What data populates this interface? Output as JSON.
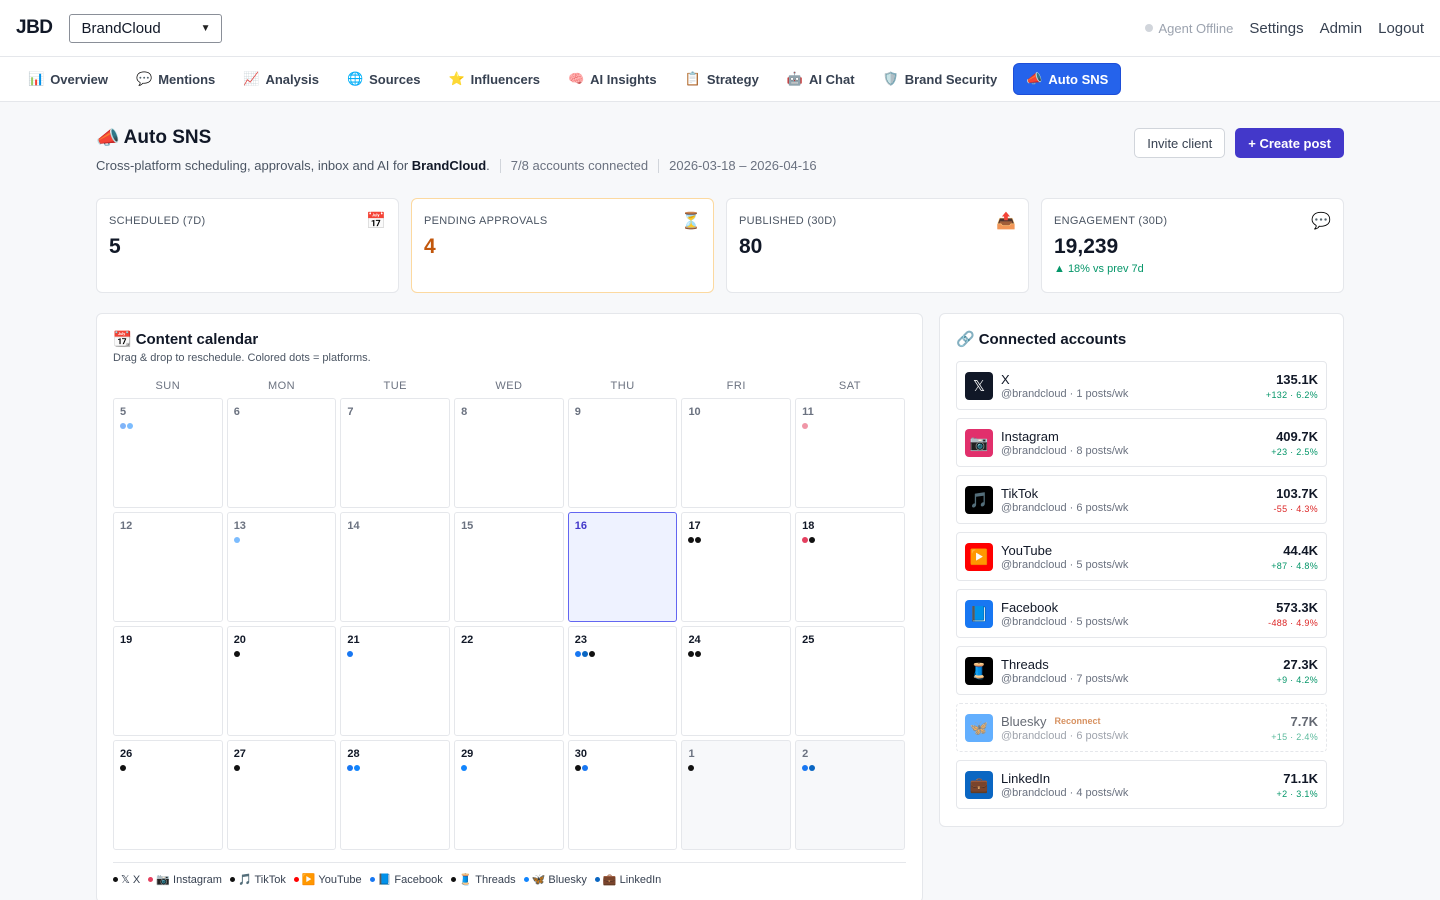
{
  "app": {
    "logo": "JBD",
    "brand_selected": "BrandCloud"
  },
  "topbar": {
    "agent_status": "Agent Offline",
    "links": [
      "Settings",
      "Admin",
      "Logout"
    ]
  },
  "nav": {
    "tabs": [
      {
        "icon": "📊",
        "label": "Overview"
      },
      {
        "icon": "💬",
        "label": "Mentions"
      },
      {
        "icon": "📈",
        "label": "Analysis"
      },
      {
        "icon": "🌐",
        "label": "Sources"
      },
      {
        "icon": "⭐",
        "label": "Influencers"
      },
      {
        "icon": "🧠",
        "label": "AI Insights"
      },
      {
        "icon": "📋",
        "label": "Strategy"
      },
      {
        "icon": "🤖",
        "label": "AI Chat"
      },
      {
        "icon": "🛡️",
        "label": "Brand Security"
      },
      {
        "icon": "📣",
        "label": "Auto SNS",
        "active": true
      }
    ]
  },
  "header": {
    "icon": "📣",
    "title": "Auto SNS",
    "subtitle_prefix": "Cross-platform scheduling, approvals, inbox and AI for ",
    "subtitle_brand": "BrandCloud",
    "subtitle_suffix": ".",
    "accounts_connected": "7/8 accounts connected",
    "date_range": "2026-03-18 – 2026-04-16",
    "invite_label": "Invite client",
    "create_label": "+ Create post"
  },
  "stats": [
    {
      "label": "SCHEDULED (7D)",
      "value": "5",
      "icon": "📅"
    },
    {
      "label": "PENDING APPROVALS",
      "value": "4",
      "icon": "⏳"
    },
    {
      "label": "PUBLISHED (30D)",
      "value": "80",
      "icon": "📤"
    },
    {
      "label": "ENGAGEMENT (30D)",
      "value": "19,239",
      "icon": "💬",
      "trend": "▲ 18% vs prev 7d"
    }
  ],
  "calendar": {
    "icon": "📆",
    "title": "Content calendar",
    "subtitle": "Drag & drop to reschedule. Colored dots = platforms.",
    "weekdays": [
      "SUN",
      "MON",
      "TUE",
      "WED",
      "THU",
      "FRI",
      "SAT"
    ],
    "platform_colors": {
      "x": "#111111",
      "instagram": "#e4405f",
      "tiktok": "#111111",
      "youtube": "#ff0000",
      "facebook": "#1877f2",
      "threads": "#111111",
      "bluesky": "#1185fe",
      "linkedin": "#0a66c2"
    },
    "days": [
      {
        "num": "5",
        "muted": true,
        "dots": [
          "facebook",
          "bluesky"
        ],
        "faded": true
      },
      {
        "num": "6",
        "muted": true,
        "dots": []
      },
      {
        "num": "7",
        "muted": true,
        "dots": []
      },
      {
        "num": "8",
        "muted": true,
        "dots": []
      },
      {
        "num": "9",
        "muted": true,
        "dots": []
      },
      {
        "num": "10",
        "muted": true,
        "dots": []
      },
      {
        "num": "11",
        "muted": true,
        "dots": [
          "instagram"
        ],
        "faded": true
      },
      {
        "num": "12",
        "muted": true,
        "dots": []
      },
      {
        "num": "13",
        "muted": true,
        "dots": [
          "bluesky"
        ],
        "faded": true
      },
      {
        "num": "14",
        "muted": true,
        "dots": []
      },
      {
        "num": "15",
        "muted": true,
        "dots": []
      },
      {
        "num": "16",
        "today": true,
        "dots": []
      },
      {
        "num": "17",
        "dots": [
          "x",
          "tiktok"
        ]
      },
      {
        "num": "18",
        "dots": [
          "instagram",
          "threads"
        ]
      },
      {
        "num": "19",
        "dots": []
      },
      {
        "num": "20",
        "dots": [
          "threads"
        ]
      },
      {
        "num": "21",
        "dots": [
          "facebook"
        ]
      },
      {
        "num": "22",
        "dots": []
      },
      {
        "num": "23",
        "dots": [
          "facebook",
          "linkedin",
          "x"
        ]
      },
      {
        "num": "24",
        "dots": [
          "x",
          "threads"
        ]
      },
      {
        "num": "25",
        "dots": []
      },
      {
        "num": "26",
        "dots": [
          "tiktok"
        ]
      },
      {
        "num": "27",
        "dots": [
          "threads"
        ]
      },
      {
        "num": "28",
        "dots": [
          "facebook",
          "bluesky"
        ]
      },
      {
        "num": "29",
        "dots": [
          "bluesky"
        ]
      },
      {
        "num": "30",
        "dots": [
          "x",
          "facebook"
        ]
      },
      {
        "num": "1",
        "outside": true,
        "dots": [
          "tiktok"
        ]
      },
      {
        "num": "2",
        "outside": true,
        "dots": [
          "facebook",
          "linkedin"
        ]
      }
    ],
    "legend": [
      {
        "key": "x",
        "label": "𝕏 X"
      },
      {
        "key": "instagram",
        "label": "📷 Instagram"
      },
      {
        "key": "tiktok",
        "label": "🎵 TikTok"
      },
      {
        "key": "youtube",
        "label": "▶️ YouTube"
      },
      {
        "key": "facebook",
        "label": "📘 Facebook"
      },
      {
        "key": "threads",
        "label": "🧵 Threads"
      },
      {
        "key": "bluesky",
        "label": "🦋 Bluesky"
      },
      {
        "key": "linkedin",
        "label": "💼 LinkedIn"
      }
    ]
  },
  "accounts": {
    "icon": "🔗",
    "title": "Connected accounts",
    "items": [
      {
        "name": "X",
        "icon": "𝕏",
        "bg": "#111827",
        "meta": "@brandcloud · 1 posts/wk",
        "count": "135.1K",
        "delta": "+132 · 6.2%",
        "dir": "up"
      },
      {
        "name": "Instagram",
        "icon": "📷",
        "bg": "#e1306c",
        "meta": "@brandcloud · 8 posts/wk",
        "count": "409.7K",
        "delta": "+23 · 2.5%",
        "dir": "up"
      },
      {
        "name": "TikTok",
        "icon": "🎵",
        "bg": "#000000",
        "meta": "@brandcloud · 6 posts/wk",
        "count": "103.7K",
        "delta": "-55 · 4.3%",
        "dir": "down"
      },
      {
        "name": "YouTube",
        "icon": "▶️",
        "bg": "#ff0000",
        "meta": "@brandcloud · 5 posts/wk",
        "count": "44.4K",
        "delta": "+87 · 4.8%",
        "dir": "up"
      },
      {
        "name": "Facebook",
        "icon": "📘",
        "bg": "#1877f2",
        "meta": "@brandcloud · 5 posts/wk",
        "count": "573.3K",
        "delta": "-488 · 4.9%",
        "dir": "down"
      },
      {
        "name": "Threads",
        "icon": "🧵",
        "bg": "#000000",
        "meta": "@brandcloud · 7 posts/wk",
        "count": "27.3K",
        "delta": "+9 · 4.2%",
        "dir": "up"
      },
      {
        "name": "Bluesky",
        "icon": "🦋",
        "bg": "#1185fe",
        "meta": "@brandcloud · 6 posts/wk",
        "count": "7.7K",
        "delta": "+15 · 2.4%",
        "dir": "up",
        "reconnect": "Reconnect"
      },
      {
        "name": "LinkedIn",
        "icon": "💼",
        "bg": "#0a66c2",
        "meta": "@brandcloud · 4 posts/wk",
        "count": "71.1K",
        "delta": "+2 · 3.1%",
        "dir": "up"
      }
    ]
  }
}
